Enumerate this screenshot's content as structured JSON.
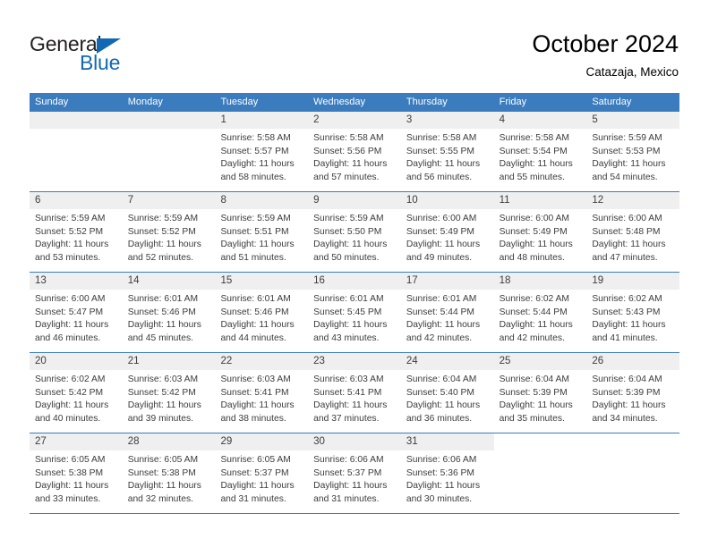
{
  "brand": {
    "name_part1": "General",
    "name_part2": "Blue",
    "triangle_icon": "triangle-icon",
    "color_primary": "#1268b3",
    "color_dark": "#231f20"
  },
  "header": {
    "title": "October 2024",
    "subtitle": "Catazaja, Mexico"
  },
  "theme": {
    "header_row_bg": "#3a7cbe",
    "day_band_bg": "#efefef",
    "divider": "#3a7cbe",
    "text": "#3c3c3c"
  },
  "weekdays": [
    "Sunday",
    "Monday",
    "Tuesday",
    "Wednesday",
    "Thursday",
    "Friday",
    "Saturday"
  ],
  "weeks": [
    [
      {
        "day": "",
        "empty": true,
        "sunrise": "",
        "sunset": "",
        "daylight1": "",
        "daylight2": ""
      },
      {
        "day": "",
        "empty": true,
        "sunrise": "",
        "sunset": "",
        "daylight1": "",
        "daylight2": ""
      },
      {
        "day": "1",
        "sunrise": "Sunrise: 5:58 AM",
        "sunset": "Sunset: 5:57 PM",
        "daylight1": "Daylight: 11 hours",
        "daylight2": "and 58 minutes."
      },
      {
        "day": "2",
        "sunrise": "Sunrise: 5:58 AM",
        "sunset": "Sunset: 5:56 PM",
        "daylight1": "Daylight: 11 hours",
        "daylight2": "and 57 minutes."
      },
      {
        "day": "3",
        "sunrise": "Sunrise: 5:58 AM",
        "sunset": "Sunset: 5:55 PM",
        "daylight1": "Daylight: 11 hours",
        "daylight2": "and 56 minutes."
      },
      {
        "day": "4",
        "sunrise": "Sunrise: 5:58 AM",
        "sunset": "Sunset: 5:54 PM",
        "daylight1": "Daylight: 11 hours",
        "daylight2": "and 55 minutes."
      },
      {
        "day": "5",
        "sunrise": "Sunrise: 5:59 AM",
        "sunset": "Sunset: 5:53 PM",
        "daylight1": "Daylight: 11 hours",
        "daylight2": "and 54 minutes."
      }
    ],
    [
      {
        "day": "6",
        "sunrise": "Sunrise: 5:59 AM",
        "sunset": "Sunset: 5:52 PM",
        "daylight1": "Daylight: 11 hours",
        "daylight2": "and 53 minutes."
      },
      {
        "day": "7",
        "sunrise": "Sunrise: 5:59 AM",
        "sunset": "Sunset: 5:52 PM",
        "daylight1": "Daylight: 11 hours",
        "daylight2": "and 52 minutes."
      },
      {
        "day": "8",
        "sunrise": "Sunrise: 5:59 AM",
        "sunset": "Sunset: 5:51 PM",
        "daylight1": "Daylight: 11 hours",
        "daylight2": "and 51 minutes."
      },
      {
        "day": "9",
        "sunrise": "Sunrise: 5:59 AM",
        "sunset": "Sunset: 5:50 PM",
        "daylight1": "Daylight: 11 hours",
        "daylight2": "and 50 minutes."
      },
      {
        "day": "10",
        "sunrise": "Sunrise: 6:00 AM",
        "sunset": "Sunset: 5:49 PM",
        "daylight1": "Daylight: 11 hours",
        "daylight2": "and 49 minutes."
      },
      {
        "day": "11",
        "sunrise": "Sunrise: 6:00 AM",
        "sunset": "Sunset: 5:49 PM",
        "daylight1": "Daylight: 11 hours",
        "daylight2": "and 48 minutes."
      },
      {
        "day": "12",
        "sunrise": "Sunrise: 6:00 AM",
        "sunset": "Sunset: 5:48 PM",
        "daylight1": "Daylight: 11 hours",
        "daylight2": "and 47 minutes."
      }
    ],
    [
      {
        "day": "13",
        "sunrise": "Sunrise: 6:00 AM",
        "sunset": "Sunset: 5:47 PM",
        "daylight1": "Daylight: 11 hours",
        "daylight2": "and 46 minutes."
      },
      {
        "day": "14",
        "sunrise": "Sunrise: 6:01 AM",
        "sunset": "Sunset: 5:46 PM",
        "daylight1": "Daylight: 11 hours",
        "daylight2": "and 45 minutes."
      },
      {
        "day": "15",
        "sunrise": "Sunrise: 6:01 AM",
        "sunset": "Sunset: 5:46 PM",
        "daylight1": "Daylight: 11 hours",
        "daylight2": "and 44 minutes."
      },
      {
        "day": "16",
        "sunrise": "Sunrise: 6:01 AM",
        "sunset": "Sunset: 5:45 PM",
        "daylight1": "Daylight: 11 hours",
        "daylight2": "and 43 minutes."
      },
      {
        "day": "17",
        "sunrise": "Sunrise: 6:01 AM",
        "sunset": "Sunset: 5:44 PM",
        "daylight1": "Daylight: 11 hours",
        "daylight2": "and 42 minutes."
      },
      {
        "day": "18",
        "sunrise": "Sunrise: 6:02 AM",
        "sunset": "Sunset: 5:44 PM",
        "daylight1": "Daylight: 11 hours",
        "daylight2": "and 42 minutes."
      },
      {
        "day": "19",
        "sunrise": "Sunrise: 6:02 AM",
        "sunset": "Sunset: 5:43 PM",
        "daylight1": "Daylight: 11 hours",
        "daylight2": "and 41 minutes."
      }
    ],
    [
      {
        "day": "20",
        "sunrise": "Sunrise: 6:02 AM",
        "sunset": "Sunset: 5:42 PM",
        "daylight1": "Daylight: 11 hours",
        "daylight2": "and 40 minutes."
      },
      {
        "day": "21",
        "sunrise": "Sunrise: 6:03 AM",
        "sunset": "Sunset: 5:42 PM",
        "daylight1": "Daylight: 11 hours",
        "daylight2": "and 39 minutes."
      },
      {
        "day": "22",
        "sunrise": "Sunrise: 6:03 AM",
        "sunset": "Sunset: 5:41 PM",
        "daylight1": "Daylight: 11 hours",
        "daylight2": "and 38 minutes."
      },
      {
        "day": "23",
        "sunrise": "Sunrise: 6:03 AM",
        "sunset": "Sunset: 5:41 PM",
        "daylight1": "Daylight: 11 hours",
        "daylight2": "and 37 minutes."
      },
      {
        "day": "24",
        "sunrise": "Sunrise: 6:04 AM",
        "sunset": "Sunset: 5:40 PM",
        "daylight1": "Daylight: 11 hours",
        "daylight2": "and 36 minutes."
      },
      {
        "day": "25",
        "sunrise": "Sunrise: 6:04 AM",
        "sunset": "Sunset: 5:39 PM",
        "daylight1": "Daylight: 11 hours",
        "daylight2": "and 35 minutes."
      },
      {
        "day": "26",
        "sunrise": "Sunrise: 6:04 AM",
        "sunset": "Sunset: 5:39 PM",
        "daylight1": "Daylight: 11 hours",
        "daylight2": "and 34 minutes."
      }
    ],
    [
      {
        "day": "27",
        "sunrise": "Sunrise: 6:05 AM",
        "sunset": "Sunset: 5:38 PM",
        "daylight1": "Daylight: 11 hours",
        "daylight2": "and 33 minutes."
      },
      {
        "day": "28",
        "sunrise": "Sunrise: 6:05 AM",
        "sunset": "Sunset: 5:38 PM",
        "daylight1": "Daylight: 11 hours",
        "daylight2": "and 32 minutes."
      },
      {
        "day": "29",
        "sunrise": "Sunrise: 6:05 AM",
        "sunset": "Sunset: 5:37 PM",
        "daylight1": "Daylight: 11 hours",
        "daylight2": "and 31 minutes."
      },
      {
        "day": "30",
        "sunrise": "Sunrise: 6:06 AM",
        "sunset": "Sunset: 5:37 PM",
        "daylight1": "Daylight: 11 hours",
        "daylight2": "and 31 minutes."
      },
      {
        "day": "31",
        "sunrise": "Sunrise: 6:06 AM",
        "sunset": "Sunset: 5:36 PM",
        "daylight1": "Daylight: 11 hours",
        "daylight2": "and 30 minutes."
      },
      {
        "day": "",
        "empty": true,
        "blank": true,
        "sunrise": "",
        "sunset": "",
        "daylight1": "",
        "daylight2": ""
      },
      {
        "day": "",
        "empty": true,
        "blank": true,
        "sunrise": "",
        "sunset": "",
        "daylight1": "",
        "daylight2": ""
      }
    ]
  ]
}
